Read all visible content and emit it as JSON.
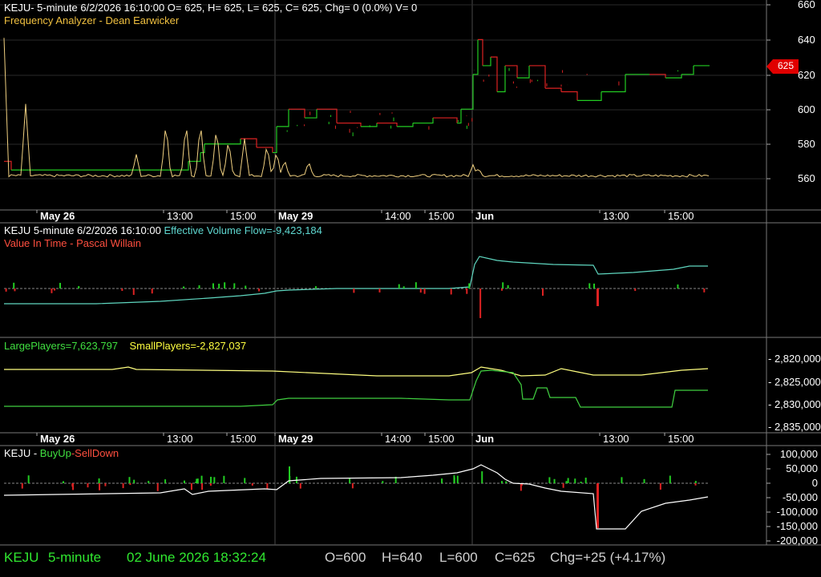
{
  "panel1": {
    "header_main": "KEJU- 5-minute 6/2/2026 16:10:00 O= 625, H= 625, L= 625, C= 625, Chg= 0 (0.0%) V= 0",
    "header_study": "Frequency Analyzer - Dean Earwicker",
    "price_label": "625",
    "y_ticks": [
      "660",
      "640",
      "620",
      "600",
      "580",
      "560"
    ]
  },
  "time_axis": {
    "labels": [
      {
        "text": "May 26",
        "bold": true
      },
      {
        "text": "13:00",
        "bold": false
      },
      {
        "text": "15:00",
        "bold": false
      },
      {
        "text": "May 29",
        "bold": true
      },
      {
        "text": "14:00",
        "bold": false
      },
      {
        "text": "15:00",
        "bold": false
      },
      {
        "text": "Jun",
        "bold": true
      },
      {
        "text": "13:00",
        "bold": false
      },
      {
        "text": "15:00",
        "bold": false
      }
    ]
  },
  "panel2": {
    "symbol": "KEJU 5-minute  6/2/2026 16:10:00",
    "study": "Effective Volume Flow=-9,423,184",
    "study2": "Value In Time - Pascal Willain"
  },
  "panel3": {
    "large": "LargePlayers=7,623,797",
    "small": "SmallPlayers=-2,827,037",
    "y_ticks": [
      "2,820,000",
      "2,825,000",
      "2,830,000",
      "2,835,000"
    ]
  },
  "panel4": {
    "symbol": "KEJU -",
    "buy": "BuyUp",
    "dash": "-",
    "sell": "SellDown",
    "y_ticks": [
      "100,000",
      "50,000",
      "0",
      "-50,000",
      "-100,000",
      "-150,000",
      "-200,000"
    ]
  },
  "status": {
    "symbol": "KEJU",
    "interval": "5-minute",
    "datetime": "02 June 2026 18:32:24",
    "open": "O=600",
    "high": "H=640",
    "low": "L=600",
    "close": "C=625",
    "change": "Chg=+25 (+4.17%)"
  },
  "colors": {
    "up": "#22cc22",
    "down": "#dd2222",
    "freq": "#f0d080",
    "evf": "#5fd7c0",
    "large": "#40d040",
    "small": "#ffff80",
    "white": "#ffffff",
    "grid": "#4a4a4a"
  },
  "chart_data": [
    {
      "type": "line",
      "title": "Frequency Analyzer - Dean Earwicker",
      "ylim": [
        550,
        665
      ],
      "x": [
        "May 26",
        "13:00",
        "15:00",
        "May 29",
        "14:00",
        "15:00",
        "Jun",
        "13:00",
        "15:00"
      ],
      "series": [
        {
          "values": [
            565,
            565,
            565,
            566,
            575,
            580,
            585,
            595,
            590,
            600,
            630,
            620,
            618,
            612,
            610,
            618,
            620,
            625
          ]
        }
      ]
    },
    {
      "type": "bar",
      "title": "KEJU - BuyUp-SellDown",
      "ylim": [
        -200000,
        100000
      ],
      "x": [
        "May 26",
        "13:00",
        "15:00",
        "May 29",
        "14:00",
        "15:00",
        "Jun",
        "13:00",
        "15:00"
      ]
    }
  ]
}
